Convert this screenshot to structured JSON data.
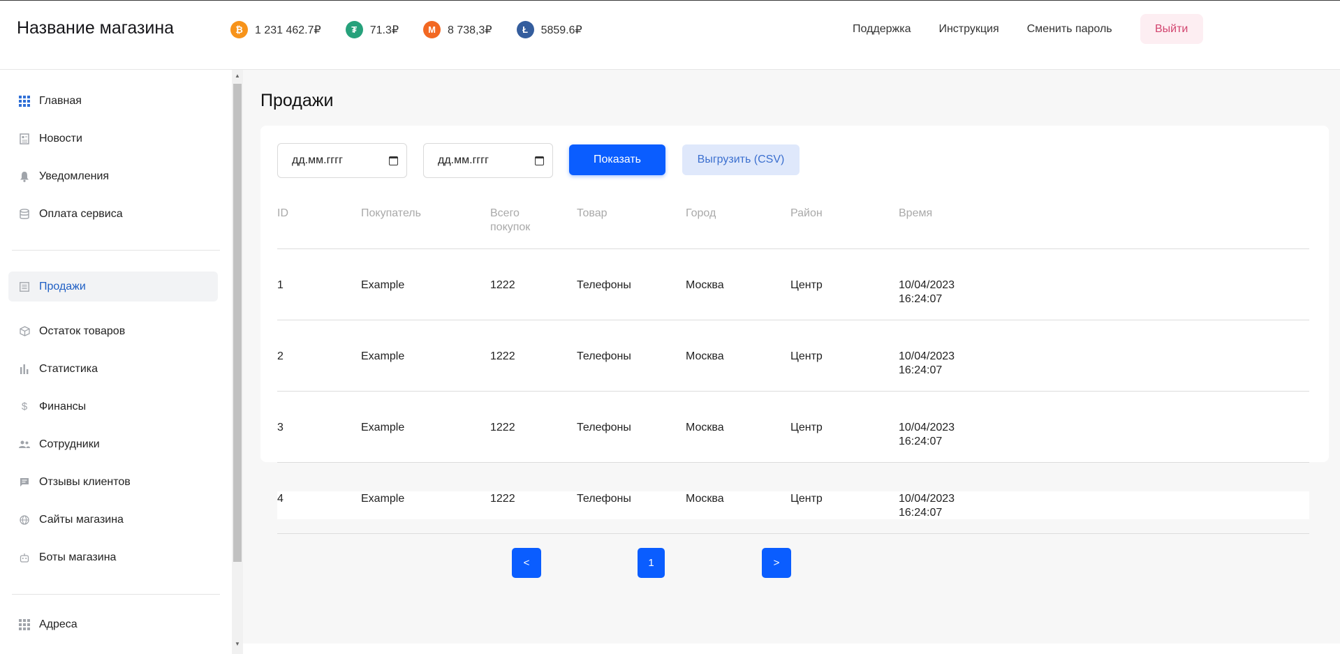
{
  "header": {
    "shop_title": "Название магазина",
    "coins": [
      {
        "icon": "bitcoin-icon",
        "symbol": "₿",
        "color": "#f7931a",
        "value": "1 231 462.7₽"
      },
      {
        "icon": "tether-icon",
        "symbol": "₮",
        "color": "#26a17b",
        "value": "71.3₽"
      },
      {
        "icon": "monero-icon",
        "symbol": "M",
        "color": "#f26822",
        "value": "8 738,3₽"
      },
      {
        "icon": "litecoin-icon",
        "symbol": "Ł",
        "color": "#345d9d",
        "value": "5859.6₽"
      }
    ],
    "nav": {
      "support": "Поддержка",
      "instructions": "Инструкция",
      "change_password": "Сменить пароль",
      "logout": "Выйти"
    }
  },
  "sidebar": {
    "items": [
      {
        "label": "Главная",
        "icon": "grid-icon"
      },
      {
        "label": "Новости",
        "icon": "newspaper-icon"
      },
      {
        "label": "Уведомления",
        "icon": "bell-icon"
      },
      {
        "label": "Оплата сервиса",
        "icon": "database-icon"
      },
      {
        "label": "Продажи",
        "icon": "list-icon",
        "active": true
      },
      {
        "label": "Остаток товаров",
        "icon": "box-icon"
      },
      {
        "label": "Статистика",
        "icon": "bar-chart-icon"
      },
      {
        "label": "Финансы",
        "icon": "dollar-icon"
      },
      {
        "label": "Сотрудники",
        "icon": "users-icon"
      },
      {
        "label": "Отзывы клиентов",
        "icon": "chat-icon"
      },
      {
        "label": "Сайты магазина",
        "icon": "globe-icon"
      },
      {
        "label": "Боты магазина",
        "icon": "bot-icon"
      },
      {
        "label": "Адреса",
        "icon": "grid-icon"
      }
    ]
  },
  "main": {
    "title": "Продажи",
    "filters": {
      "date_from_placeholder": "дд.мм.гггг",
      "date_to_placeholder": "дд.мм.гггг",
      "show_button": "Показать",
      "export_button": "Выгрузить (CSV)"
    },
    "table": {
      "headers": [
        "ID",
        "Покупатель",
        "Всего покупок",
        "Товар",
        "Город",
        "Район",
        "Время"
      ],
      "header_total_line1": "Всего",
      "header_total_line2": "покупок",
      "rows": [
        {
          "id": "1",
          "buyer": "Example",
          "total": "1222",
          "product": "Телефоны",
          "city": "Москва",
          "district": "Центр",
          "date": "10/04/2023",
          "time": "16:24:07"
        },
        {
          "id": "2",
          "buyer": "Example",
          "total": "1222",
          "product": "Телефоны",
          "city": "Москва",
          "district": "Центр",
          "date": "10/04/2023",
          "time": "16:24:07"
        },
        {
          "id": "3",
          "buyer": "Example",
          "total": "1222",
          "product": "Телефоны",
          "city": "Москва",
          "district": "Центр",
          "date": "10/04/2023",
          "time": "16:24:07"
        },
        {
          "id": "4",
          "buyer": "Example",
          "total": "1222",
          "product": "Телефоны",
          "city": "Москва",
          "district": "Центр",
          "date": "10/04/2023",
          "time": "16:24:07"
        }
      ]
    },
    "pagination": {
      "prev": "<",
      "current": "1",
      "next": ">"
    }
  }
}
